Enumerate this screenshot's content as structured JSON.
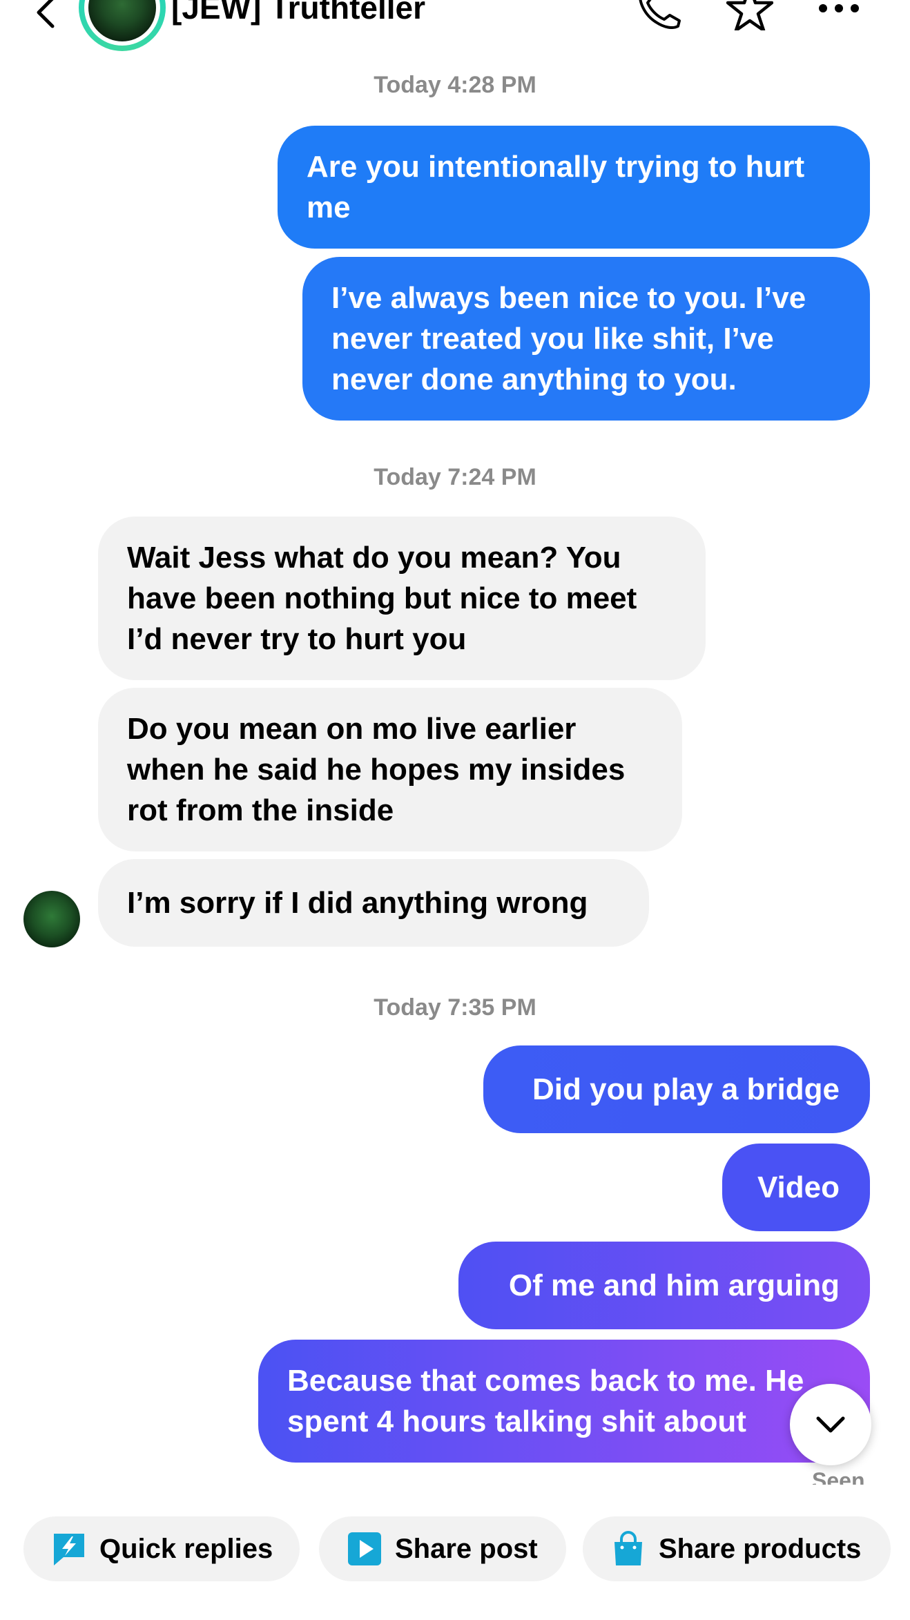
{
  "header": {
    "contact_name": "[JEW] Truthteller",
    "icons": [
      "back-icon",
      "phone-icon",
      "star-icon",
      "more-icon"
    ]
  },
  "timestamps": [
    "Today 4:28 PM",
    "Today 7:24 PM",
    "Today 7:35 PM"
  ],
  "messages": [
    {
      "direction": "outgoing",
      "lines": [
        "Are you intentionally trying to hurt",
        "me"
      ]
    },
    {
      "direction": "outgoing",
      "lines": [
        "I’ve always been nice to you. I’ve",
        "never treated you like shit, I’ve",
        "never done anything to you."
      ]
    },
    {
      "direction": "incoming",
      "lines": [
        "Wait Jess what do you mean? You",
        "have been nothing but nice to meet",
        "I’d never try to hurt you"
      ]
    },
    {
      "direction": "incoming",
      "lines": [
        "Do you mean on mo live earlier",
        "when he said he hopes my insides",
        "rot from the inside"
      ]
    },
    {
      "direction": "incoming",
      "lines": [
        "I’m sorry if I did anything wrong"
      ]
    },
    {
      "direction": "outgoing",
      "lines": [
        "Did you play a bridge"
      ]
    },
    {
      "direction": "outgoing",
      "lines": [
        "Video"
      ]
    },
    {
      "direction": "outgoing",
      "lines": [
        "Of me and him arguing"
      ]
    },
    {
      "direction": "outgoing",
      "lines": [
        "Because that comes back to me. He",
        "spent 4 hours talking shit about"
      ]
    }
  ],
  "status": {
    "seen": "Seen"
  },
  "shortcuts": [
    {
      "label": "Quick replies",
      "icon": "lightning-bubble-icon"
    },
    {
      "label": "Share post",
      "icon": "play-square-icon"
    },
    {
      "label": "Share products",
      "icon": "shopping-bag-icon"
    }
  ],
  "colors": {
    "outgoing_blue": "#1f7cf7",
    "outgoing_purple": "#8f4cf5",
    "incoming_bg": "#f2f2f2",
    "timestamp": "#8a8a8a",
    "chip_icon": "#16a7d6"
  }
}
